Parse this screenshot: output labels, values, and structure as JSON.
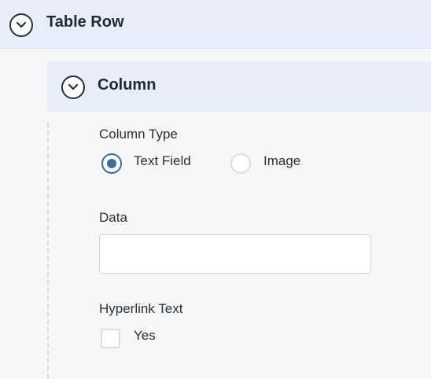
{
  "table_row": {
    "title": "Table Row",
    "toggle_icon": "chevron-down-icon"
  },
  "column": {
    "title": "Column",
    "toggle_icon": "chevron-down-icon",
    "column_type": {
      "label": "Column Type",
      "options": [
        {
          "label": "Text Field",
          "selected": true
        },
        {
          "label": "Image",
          "selected": false
        }
      ]
    },
    "data_field": {
      "label": "Data",
      "value": "",
      "placeholder": ""
    },
    "hyperlink_text": {
      "label": "Hyperlink Text",
      "checkbox_label": "Yes",
      "checked": false
    }
  },
  "colors": {
    "header_bg": "#e8eef7",
    "accent": "#3a6d98",
    "page_bg": "#f7f7f7"
  }
}
